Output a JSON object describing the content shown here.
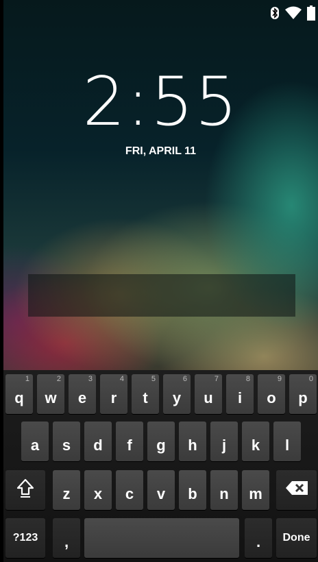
{
  "status_bar": {
    "icons": [
      "bluetooth-icon",
      "wifi-icon",
      "battery-icon"
    ]
  },
  "lockscreen": {
    "time": "2:55",
    "date": "FRI, APRIL 11",
    "password_placeholder": ""
  },
  "keyboard": {
    "row1": [
      {
        "label": "q",
        "hint": "1"
      },
      {
        "label": "w",
        "hint": "2"
      },
      {
        "label": "e",
        "hint": "3"
      },
      {
        "label": "r",
        "hint": "4"
      },
      {
        "label": "t",
        "hint": "5"
      },
      {
        "label": "y",
        "hint": "6"
      },
      {
        "label": "u",
        "hint": "7"
      },
      {
        "label": "i",
        "hint": "8"
      },
      {
        "label": "o",
        "hint": "9"
      },
      {
        "label": "p",
        "hint": "0"
      }
    ],
    "row2": [
      "a",
      "s",
      "d",
      "f",
      "g",
      "h",
      "j",
      "k",
      "l"
    ],
    "row3": [
      "z",
      "x",
      "c",
      "v",
      "b",
      "n",
      "m"
    ],
    "shift_icon": "shift-icon",
    "delete_icon": "backspace-icon",
    "symbols_label": "?123",
    "comma_label": ",",
    "period_label": ".",
    "done_label": "Done"
  },
  "colors": {
    "key_bg": "#444444",
    "keyboard_bg": "#1a1a1a"
  }
}
